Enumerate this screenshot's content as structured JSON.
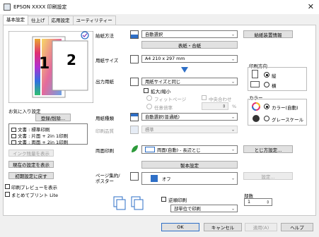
{
  "window": {
    "title": "EPSON XXXX 印刷設定",
    "close_glyph": "✕"
  },
  "tabs": [
    "基本設定",
    "仕上げ",
    "応用設定",
    "ユーティリティー"
  ],
  "preview": {
    "pages": [
      "1",
      "2"
    ]
  },
  "favorites": {
    "title": "お気に入り設定",
    "register_button": "登録/削除...",
    "items": [
      "文書 : 標準印刷",
      "文書 : 片面 + 2in 1印刷",
      "文書 : 両面 + 2in 1印刷"
    ]
  },
  "left_buttons": {
    "ink": "インク残量を表示",
    "show_current": "現在の設定を表示",
    "reset": "初期設定に戻す",
    "print_preview": "印刷プレビューを表示",
    "lite": "まとめてプリント Lite"
  },
  "paper_source": {
    "label": "給紙方法",
    "value": "自動選択",
    "sub_button": "表紙・合紙",
    "info_button": "給紙装置情報"
  },
  "paper_size": {
    "label": "用紙サイズ",
    "value": "A4 210 x 297 mm"
  },
  "output_paper": {
    "label": "出力用紙",
    "value": "用紙サイズと同じ",
    "reduce": "拡大/縮小",
    "fit_page": "フィットページ",
    "center": "中央合わせ",
    "any_scale": "任意倍率",
    "percent": "%"
  },
  "paper_type": {
    "label": "用紙種類",
    "value": "自動選択(普通紙)"
  },
  "print_quality": {
    "label": "印刷品質",
    "value": "標準"
  },
  "orientation": {
    "title": "印刷方向",
    "portrait": "縦",
    "landscape": "横",
    "selected": "portrait"
  },
  "color": {
    "title": "カラー",
    "color_auto": "カラー(自動)",
    "grayscale": "グレースケール",
    "selected": "color_auto"
  },
  "duplex": {
    "label": "両面印刷",
    "value": "両面(自動) - 長辺とじ",
    "settings_button": "とじ方設定...",
    "booklet_button": "製本設定"
  },
  "pages_per_sheet": {
    "label1": "ページ集約/",
    "label2": "ポスター",
    "value": "オフ",
    "settings_button": "設定..."
  },
  "order": {
    "reverse": "逆順印刷",
    "collate_value": "部単位で印刷",
    "copies_label": "部数",
    "copies_value": "1"
  },
  "bottom_buttons": {
    "ok": "OK",
    "cancel": "キャンセル",
    "apply": "適用(A)",
    "help": "ヘルプ"
  },
  "colors": {
    "panel_bg": "#ffffff",
    "window_bg": "#f0f0f0",
    "accent_blue": "#2e6fc7",
    "green_icon": "#2c9a3a"
  }
}
